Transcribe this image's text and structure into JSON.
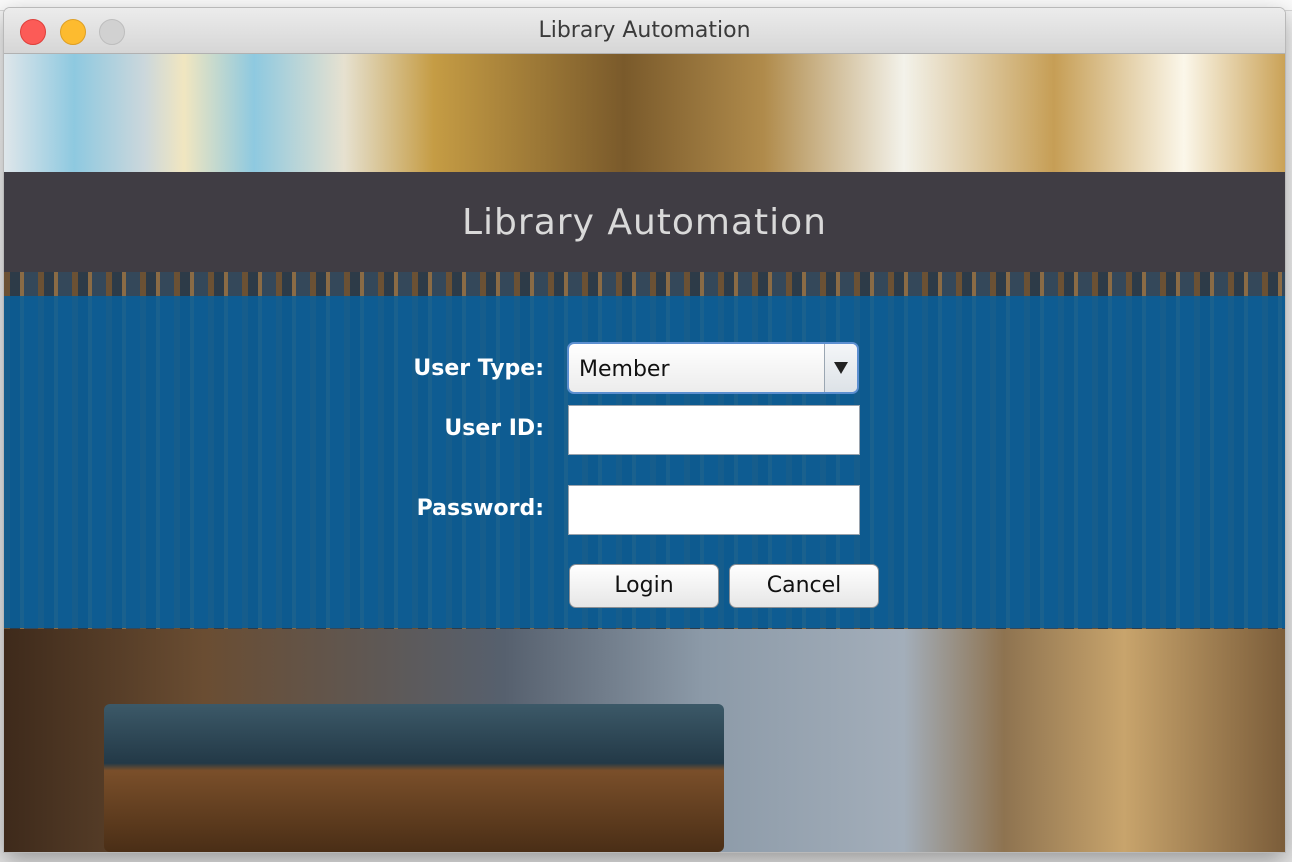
{
  "window": {
    "title": "Library Automation"
  },
  "header": {
    "title": "Library Automation"
  },
  "form": {
    "user_type_label": "User Type:",
    "user_type_value": "Member",
    "user_id_label": "User ID:",
    "user_id_value": "",
    "password_label": "Password:",
    "password_value": "",
    "login_label": "Login",
    "cancel_label": "Cancel"
  },
  "colors": {
    "header_band": "#403d44",
    "form_band": "#08609b",
    "traffic_close": "#fc5b57",
    "traffic_minimize": "#fdbb2f",
    "traffic_zoom_disabled": "#d1d1d1"
  }
}
